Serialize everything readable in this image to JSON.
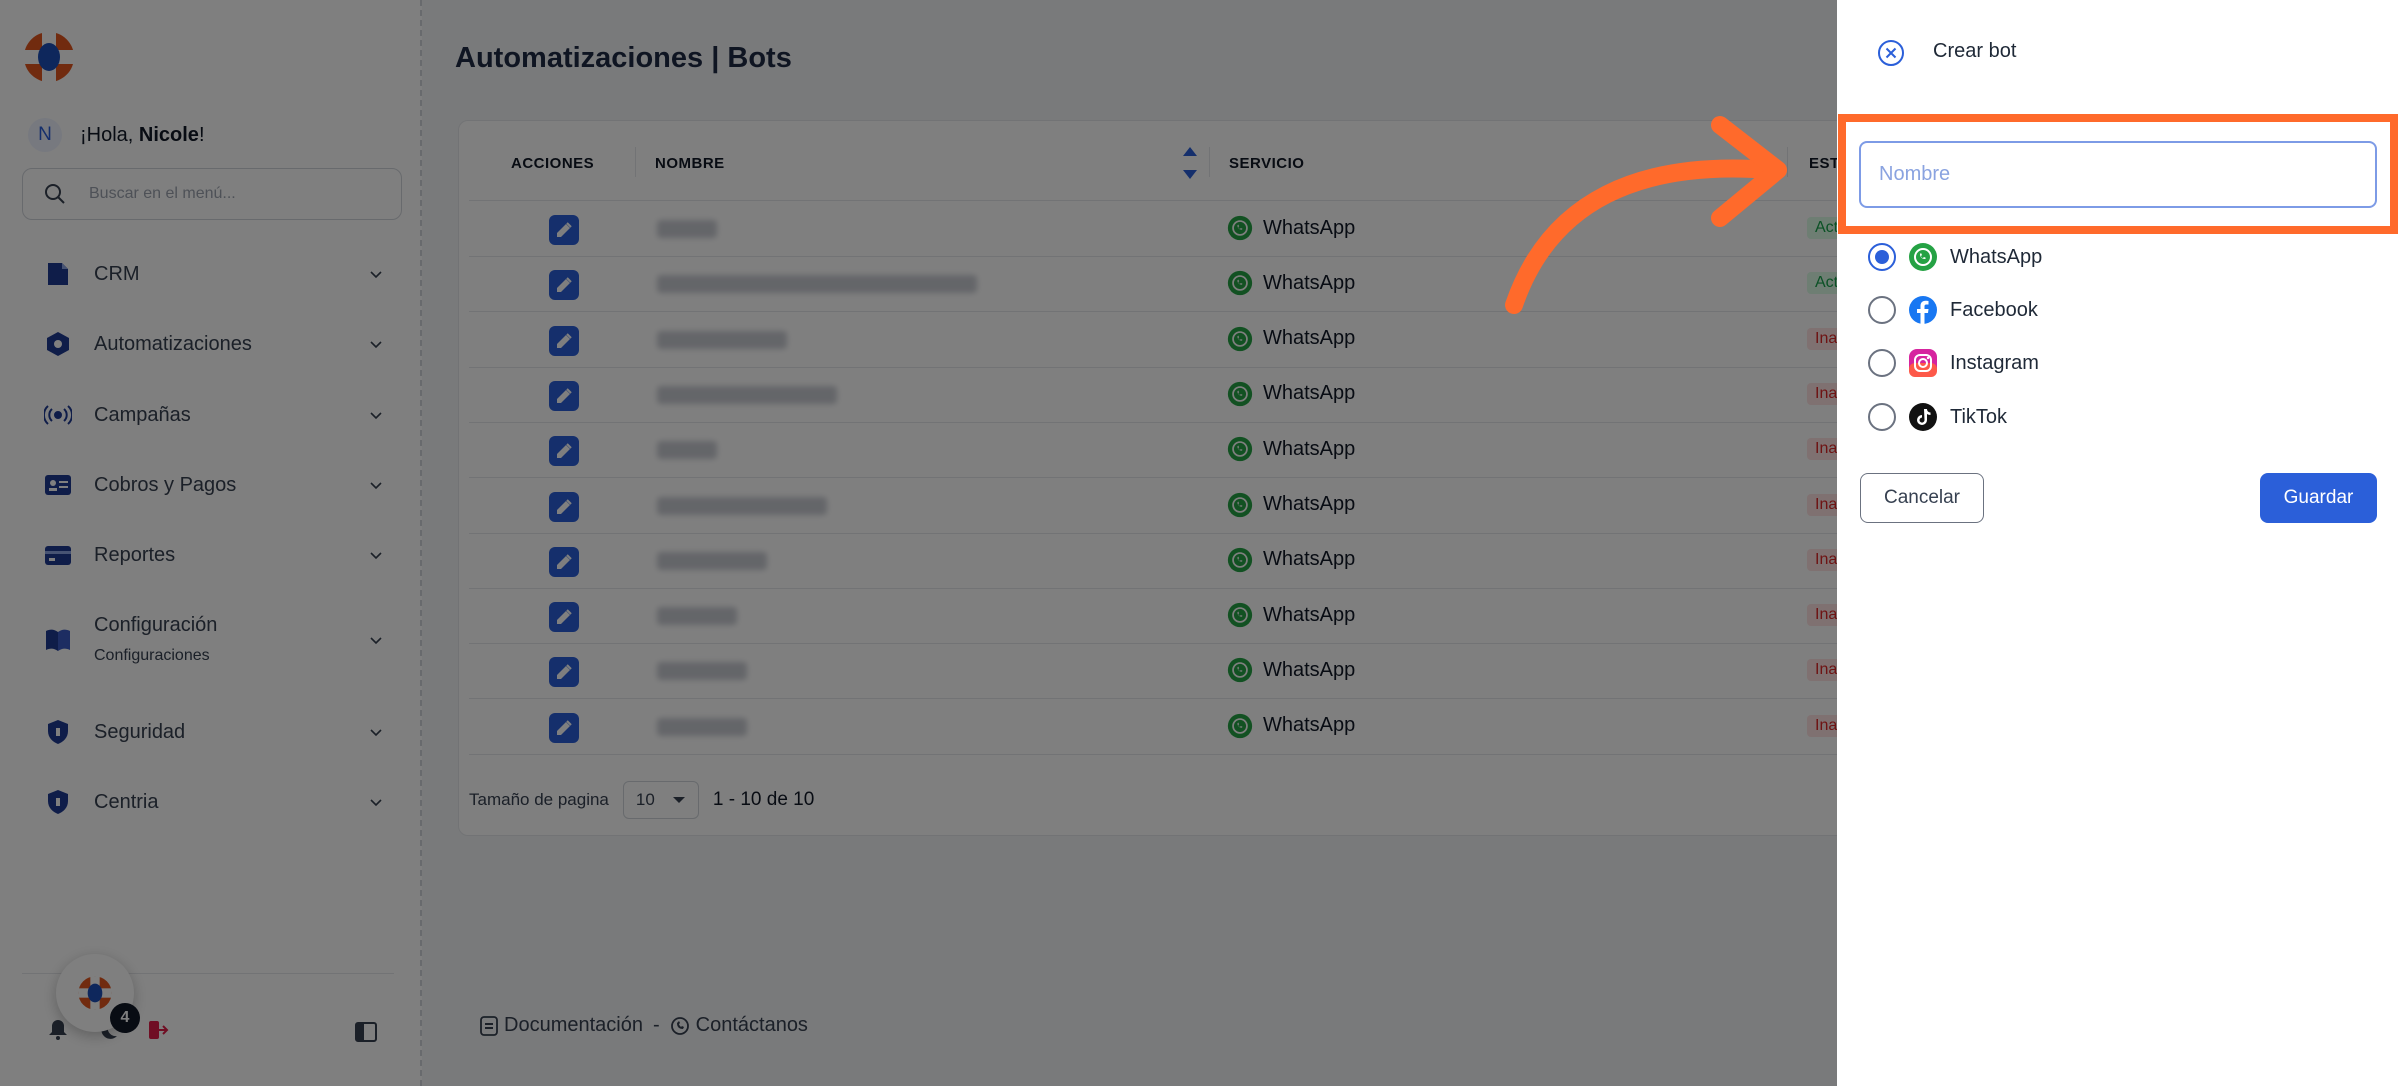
{
  "sidebar": {
    "greeting_prefix": "¡Hola, ",
    "user_name": "Nicole",
    "greeting_suffix": "!",
    "avatar_initial": "N",
    "search_placeholder": "Buscar en el menú...",
    "items": [
      {
        "label": "CRM",
        "icon": "document-icon"
      },
      {
        "label": "Automatizaciones",
        "icon": "hexagon-gear-icon"
      },
      {
        "label": "Campañas",
        "icon": "broadcast-icon"
      },
      {
        "label": "Cobros y Pagos",
        "icon": "id-card-icon"
      },
      {
        "label": "Reportes",
        "icon": "credit-card-icon"
      },
      {
        "label": "Configuración",
        "sublabel": "Configuraciones",
        "icon": "book-icon"
      },
      {
        "label": "Seguridad",
        "icon": "shield-icon"
      },
      {
        "label": "Centria",
        "icon": "shield-icon"
      }
    ],
    "notification_badge": "4"
  },
  "main": {
    "title": "Automatizaciones | Bots",
    "columns": {
      "acciones": "ACCIONES",
      "nombre": "NOMBRE",
      "servicio": "SERVICIO",
      "estado": "ESTA"
    },
    "rows": [
      {
        "service": "WhatsApp",
        "status": "Act"
      },
      {
        "service": "WhatsApp",
        "status": "Act"
      },
      {
        "service": "WhatsApp",
        "status": "Ina"
      },
      {
        "service": "WhatsApp",
        "status": "Ina"
      },
      {
        "service": "WhatsApp",
        "status": "Ina"
      },
      {
        "service": "WhatsApp",
        "status": "Ina"
      },
      {
        "service": "WhatsApp",
        "status": "Ina"
      },
      {
        "service": "WhatsApp",
        "status": "Ina"
      },
      {
        "service": "WhatsApp",
        "status": "Ina"
      },
      {
        "service": "WhatsApp",
        "status": "Ina"
      }
    ],
    "pagination": {
      "label": "Tamaño de pagina",
      "page_size": "10",
      "range": "1 - 10 de 10"
    },
    "footer": {
      "docs": "Documentación",
      "separator": "-",
      "contact": "Contáctanos"
    }
  },
  "drawer": {
    "title": "Crear bot",
    "name_placeholder": "Nombre",
    "name_value": "",
    "services": [
      {
        "label": "WhatsApp",
        "selected": true
      },
      {
        "label": "Facebook",
        "selected": false
      },
      {
        "label": "Instagram",
        "selected": false
      },
      {
        "label": "TikTok",
        "selected": false
      }
    ],
    "cancel_label": "Cancelar",
    "save_label": "Guardar"
  },
  "colors": {
    "accent": "#2b5fd9",
    "highlight": "#ff6a2b",
    "whatsapp": "#25a244",
    "active": "#16a34a",
    "inactive": "#dc2626"
  }
}
